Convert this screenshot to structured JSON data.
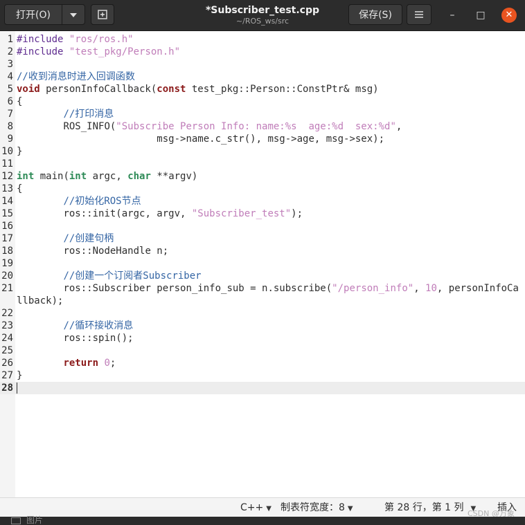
{
  "header": {
    "open_label": "打开(O)",
    "open_menu_icon": "chevron-down-icon",
    "new_tab_icon": "new-tab-icon",
    "title": "*Subscriber_test.cpp",
    "subtitle": "~/ROS_ws/src",
    "save_label": "保存(S)",
    "menu_icon": "hamburger-menu-icon"
  },
  "window_controls": {
    "minimize": "–",
    "maximize": "□",
    "close": "✕"
  },
  "editor": {
    "current_line": 28,
    "lines": [
      {
        "n": "1",
        "text": "#include \"ros/ros.h\""
      },
      {
        "n": "2",
        "text": "#include \"test_pkg/Person.h\""
      },
      {
        "n": "3",
        "text": ""
      },
      {
        "n": "4",
        "text": "//收到消息时进入回调函数"
      },
      {
        "n": "5",
        "text": "void personInfoCallback(const test_pkg::Person::ConstPtr& msg)"
      },
      {
        "n": "6",
        "text": "{"
      },
      {
        "n": "7",
        "text": "        //打印消息"
      },
      {
        "n": "8",
        "text": "        ROS_INFO(\"Subscribe Person Info: name:%s  age:%d  sex:%d\","
      },
      {
        "n": "9",
        "text": "                        msg->name.c_str(), msg->age, msg->sex);"
      },
      {
        "n": "10",
        "text": "}"
      },
      {
        "n": "11",
        "text": ""
      },
      {
        "n": "12",
        "text": "int main(int argc, char **argv)"
      },
      {
        "n": "13",
        "text": "{"
      },
      {
        "n": "14",
        "text": "        //初始化ROS节点"
      },
      {
        "n": "15",
        "text": "        ros::init(argc, argv, \"Subscriber_test\");"
      },
      {
        "n": "16",
        "text": ""
      },
      {
        "n": "17",
        "text": "        //创建句柄"
      },
      {
        "n": "18",
        "text": "        ros::NodeHandle n;"
      },
      {
        "n": "19",
        "text": ""
      },
      {
        "n": "20",
        "text": "        //创建一个订阅者Subscriber"
      },
      {
        "n": "21",
        "text": "        ros::Subscriber person_info_sub = n.subscribe(\"/person_info\", 10, personInfoCallback);"
      },
      {
        "n": "22",
        "text": ""
      },
      {
        "n": "23",
        "text": "        //循环接收消息"
      },
      {
        "n": "24",
        "text": "        ros::spin();"
      },
      {
        "n": "25",
        "text": ""
      },
      {
        "n": "26",
        "text": "        return 0;"
      },
      {
        "n": "27",
        "text": "}"
      },
      {
        "n": "28",
        "text": ""
      }
    ]
  },
  "statusbar": {
    "language": "C++",
    "tab_width": "制表符宽度：8",
    "position": "第 28 行，第 1 列",
    "insert_mode": "插入"
  },
  "watermark": "CSDN @万象",
  "taskbar": {
    "label": "图片"
  },
  "colors": {
    "comment": "#3465a4",
    "string": "#c07db9",
    "preprocessor": "#5e2b8f",
    "keyword": "#8b1a1a",
    "type": "#2e8b57",
    "close_button": "#e95420"
  }
}
